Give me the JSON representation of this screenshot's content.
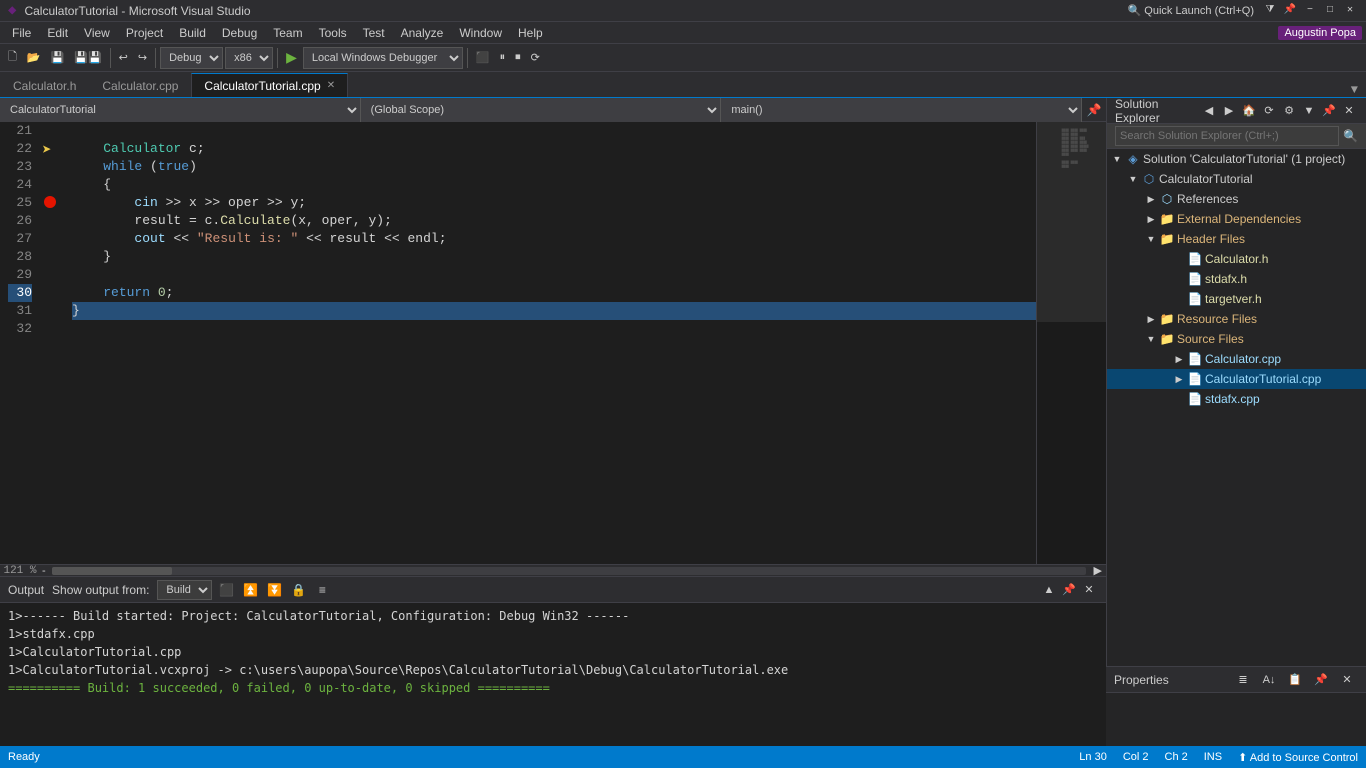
{
  "titleBar": {
    "title": "CalculatorTutorial - Microsoft Visual Studio",
    "quickLaunch": "Quick Launch (Ctrl+Q)"
  },
  "menuBar": {
    "items": [
      "File",
      "Edit",
      "View",
      "Project",
      "Build",
      "Debug",
      "Team",
      "Tools",
      "Test",
      "Analyze",
      "Window",
      "Help"
    ]
  },
  "toolbar": {
    "debugConfig": "Debug",
    "platform": "x86",
    "debugTarget": "Local Windows Debugger"
  },
  "tabs": {
    "items": [
      {
        "label": "Calculator.h",
        "active": false
      },
      {
        "label": "Calculator.cpp",
        "active": false
      },
      {
        "label": "CalculatorTutorial.cpp",
        "active": true
      }
    ]
  },
  "editor": {
    "navLeft": "CalculatorTutorial",
    "navMiddle": "(Global Scope)",
    "navRight": "main()",
    "lines": [
      {
        "num": "21",
        "code": "    Calculator c;",
        "breakpoint": false
      },
      {
        "num": "22",
        "code": "    while (true)",
        "breakpoint": false
      },
      {
        "num": "23",
        "code": "    {",
        "breakpoint": false
      },
      {
        "num": "24",
        "code": "        cin >> x >> oper >> y;",
        "breakpoint": false
      },
      {
        "num": "25",
        "code": "        result = c.Calculate(x, oper, y);",
        "breakpoint": true
      },
      {
        "num": "26",
        "code": "        cout << \"Result is: \" << result << endl;",
        "breakpoint": false
      },
      {
        "num": "27",
        "code": "    }",
        "breakpoint": false
      },
      {
        "num": "28",
        "code": "",
        "breakpoint": false
      },
      {
        "num": "29",
        "code": "    return 0;",
        "breakpoint": false
      },
      {
        "num": "30",
        "code": "}",
        "breakpoint": false,
        "selected": true
      },
      {
        "num": "31",
        "code": "",
        "breakpoint": false
      },
      {
        "num": "32",
        "code": "",
        "breakpoint": false
      }
    ]
  },
  "solutionExplorer": {
    "title": "Solution Explorer",
    "searchPlaceholder": "Search Solution Explorer (Ctrl+;)",
    "tree": {
      "solution": "Solution 'CalculatorTutorial' (1 project)",
      "project": "CalculatorTutorial",
      "references": "References",
      "externalDeps": "External Dependencies",
      "headerFiles": "Header Files",
      "headers": [
        "Calculator.h",
        "stdafx.h",
        "targetver.h"
      ],
      "resourceFiles": "Resource Files",
      "sourceFiles": "Source Files",
      "sources": [
        "Calculator.cpp",
        "CalculatorTutorial.cpp",
        "stdafx.cpp"
      ]
    }
  },
  "properties": {
    "title": "Properties"
  },
  "output": {
    "title": "Output",
    "showOutputFrom": "Show output from:",
    "source": "Build",
    "lines": [
      "1>------ Build started: Project: CalculatorTutorial, Configuration: Debug Win32 ------",
      "1>stdafx.cpp",
      "1>CalculatorTutorial.cpp",
      "1>CalculatorTutorial.vcxproj -> c:\\users\\aupopa\\Source\\Repos\\CalculatorTutorial\\Debug\\CalculatorTutorial.exe",
      "========== Build: 1 succeeded, 0 failed, 0 up-to-date, 0 skipped =========="
    ]
  },
  "statusBar": {
    "ready": "Ready",
    "line": "Ln 30",
    "col": "Col 2",
    "ch": "Ch 2",
    "ins": "INS",
    "sourceControl": "Add to Source Control"
  },
  "zoom": "121 %",
  "user": "Augustin Popa"
}
